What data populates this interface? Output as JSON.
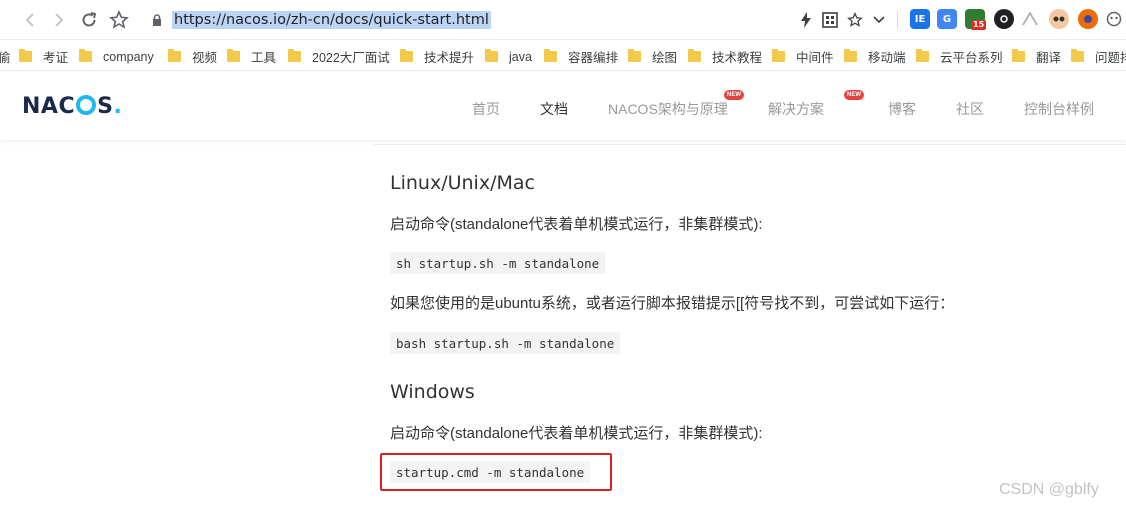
{
  "browser": {
    "url": "https://nacos.io/zh-cn/docs/quick-start.html",
    "extension_badge": "15",
    "extension_labels": [
      "IE",
      "G",
      "",
      "",
      "",
      "",
      "",
      ""
    ]
  },
  "bookmarks": [
    {
      "label": "考证"
    },
    {
      "label": "company"
    },
    {
      "label": "视频"
    },
    {
      "label": "工具"
    },
    {
      "label": "2022大厂面试"
    },
    {
      "label": "技术提升"
    },
    {
      "label": "java"
    },
    {
      "label": "容器编排"
    },
    {
      "label": "绘图"
    },
    {
      "label": "技术教程"
    },
    {
      "label": "中间件"
    },
    {
      "label": "移动端"
    },
    {
      "label": "云平台系列"
    },
    {
      "label": "翻译"
    },
    {
      "label": "问题排"
    }
  ],
  "bookmarks_leading_fragment": "偷",
  "site": {
    "logo_letters": [
      "N",
      "A",
      "C",
      "S"
    ],
    "logo_dot": ".",
    "menu": [
      {
        "label": "首页",
        "active": false,
        "new": false
      },
      {
        "label": "文档",
        "active": true,
        "new": false
      },
      {
        "label": "NACOS架构与原理",
        "active": false,
        "new": true
      },
      {
        "label": "解决方案",
        "active": false,
        "new": true
      },
      {
        "label": "博客",
        "active": false,
        "new": false
      },
      {
        "label": "社区",
        "active": false,
        "new": false
      },
      {
        "label": "控制台样例",
        "active": false,
        "new": false
      }
    ],
    "new_badge_text": "NEW"
  },
  "content": {
    "linux_heading": "Linux/Unix/Mac",
    "linux_desc": "启动命令(standalone代表着单机模式运行，非集群模式):",
    "linux_cmd": "sh startup.sh -m standalone",
    "ubuntu_note": "如果您使用的是ubuntu系统，或者运行脚本报错提示[[符号找不到，可尝试如下运行：",
    "ubuntu_cmd": "bash startup.sh -m standalone",
    "windows_heading": "Windows",
    "windows_desc": "启动命令(standalone代表着单机模式运行，非集群模式):",
    "windows_cmd": "startup.cmd -m standalone"
  },
  "watermark": "CSDN @gblfy",
  "colors": {
    "accent_blue": "#1fb7ef",
    "highlight_red": "#e02020",
    "new_badge": "#e4433d",
    "url_selection": "#bcd5f5"
  }
}
